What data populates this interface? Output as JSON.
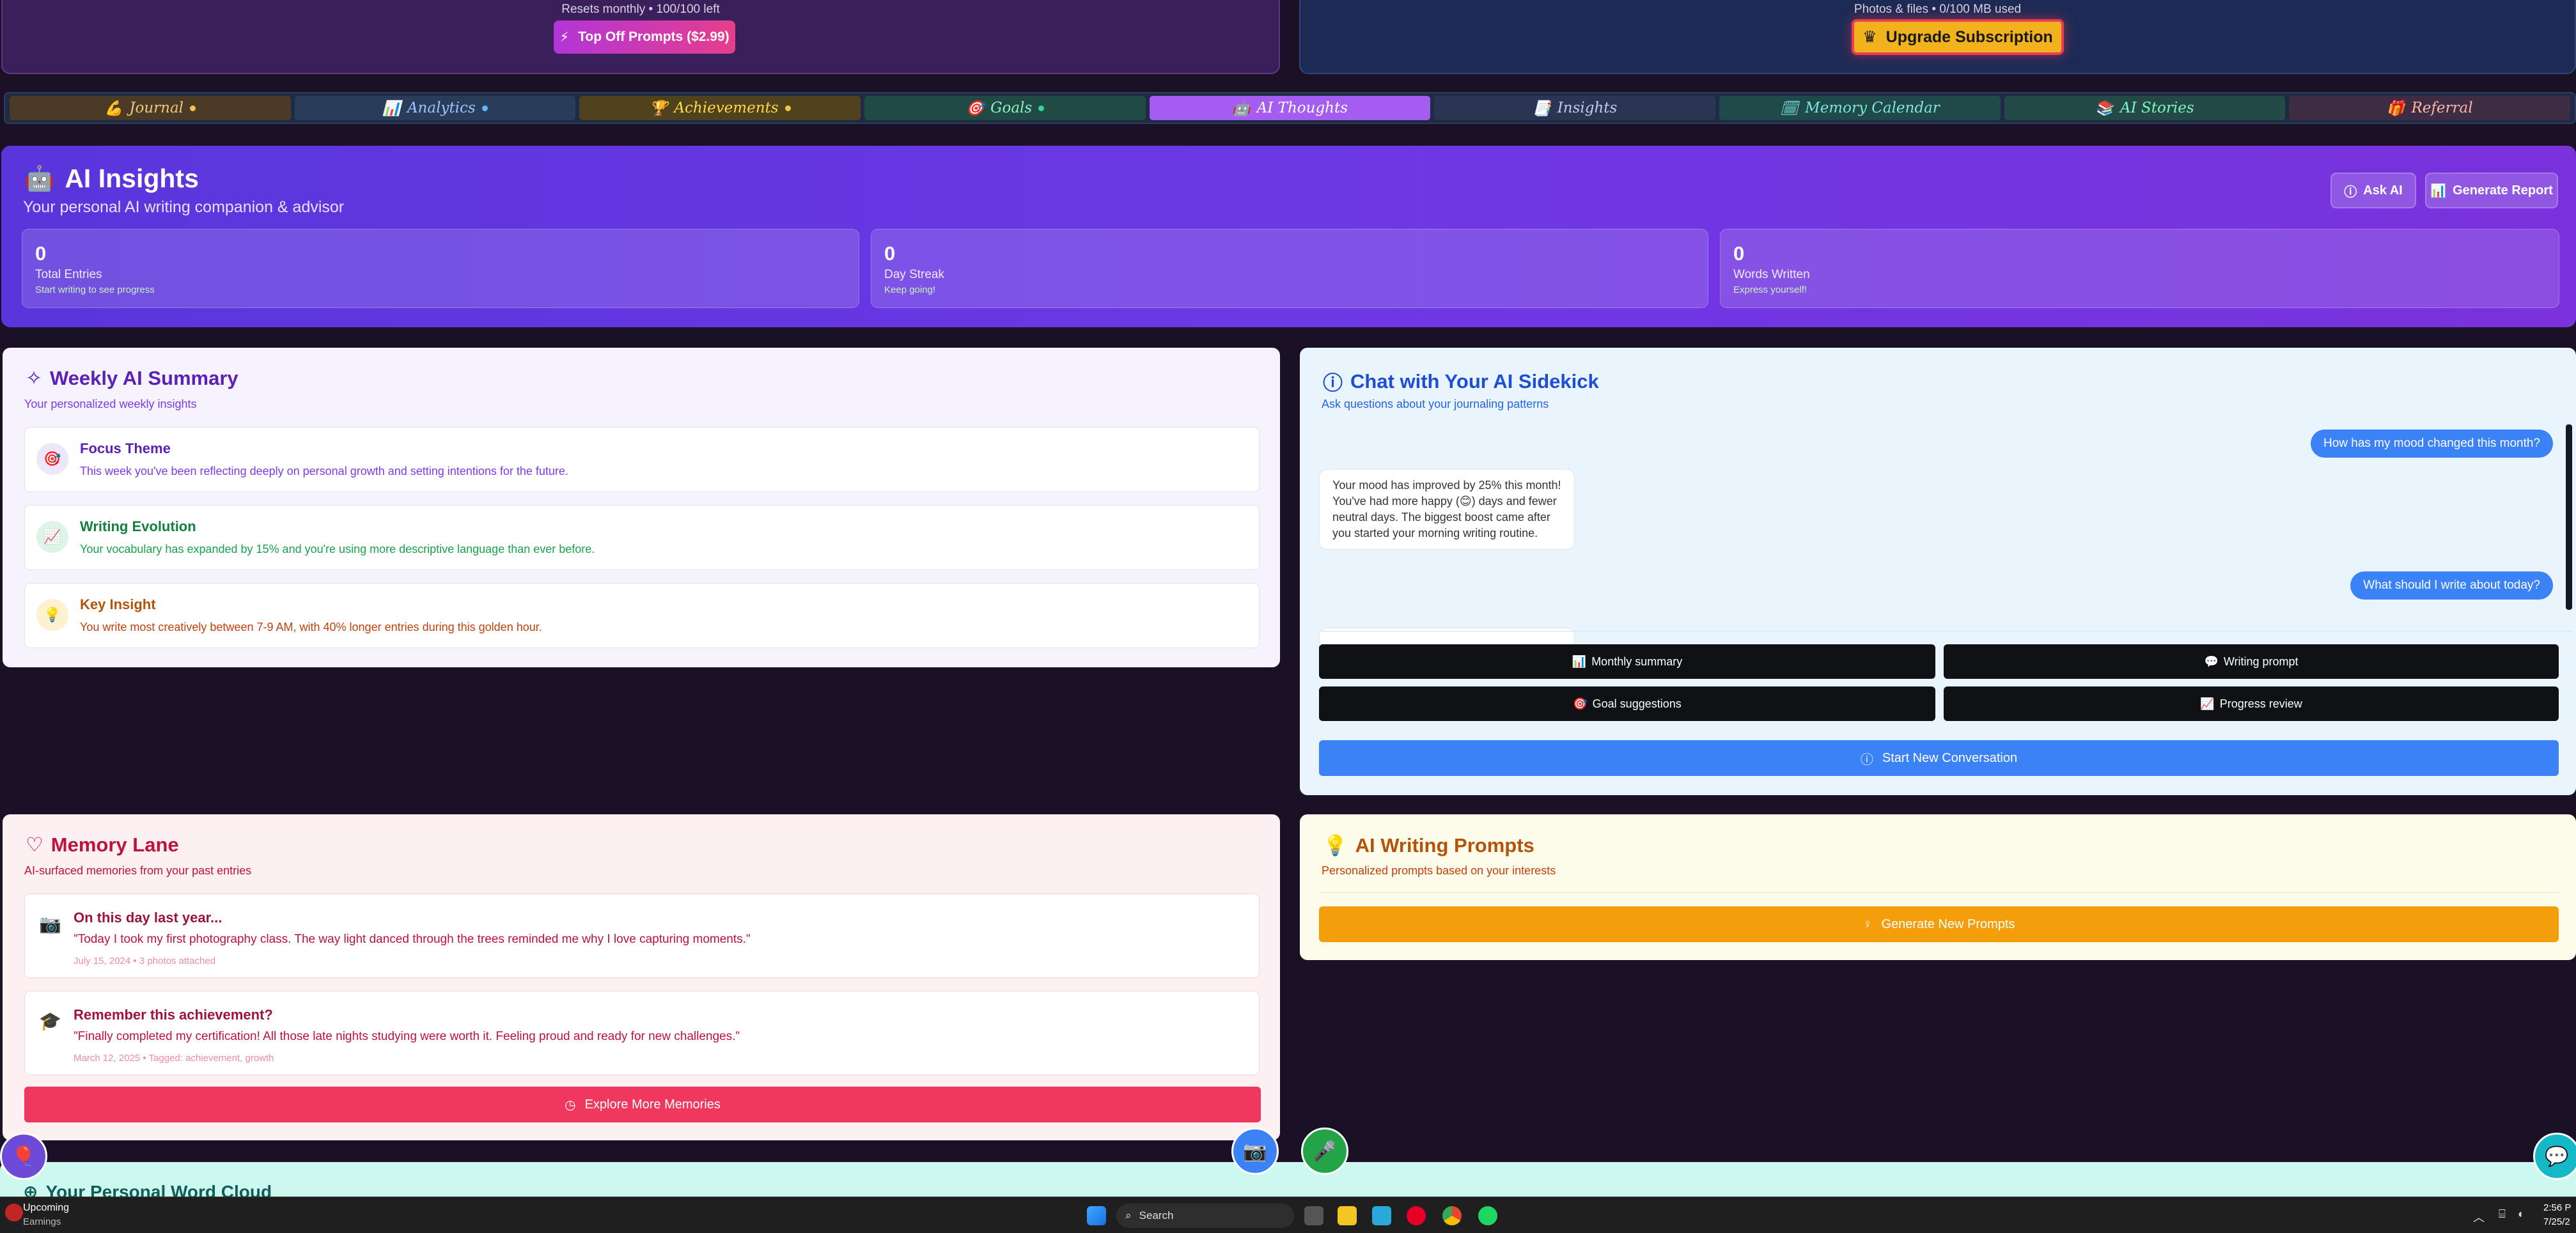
{
  "plan": {
    "prompts_note": "Resets monthly • 100/100 left",
    "topoff_label": "Top Off Prompts ($2.99)",
    "storage_note": "Photos & files • 0/100 MB used",
    "upgrade_label": "Upgrade Subscription"
  },
  "tabs": [
    {
      "icon": "💪",
      "label": "Journal"
    },
    {
      "icon": "📊",
      "label": "Analytics"
    },
    {
      "icon": "🏆",
      "label": "Achievements"
    },
    {
      "icon": "🎯",
      "label": "Goals"
    },
    {
      "icon": "🤖",
      "label": "AI Thoughts"
    },
    {
      "icon": "📑",
      "label": "Insights"
    },
    {
      "icon": "🗓",
      "label": "Memory Calendar"
    },
    {
      "icon": "📚",
      "label": "AI Stories"
    },
    {
      "icon": "🎁",
      "label": "Referral"
    }
  ],
  "hero": {
    "title": "AI Insights",
    "subtitle": "Your personal AI writing companion & advisor",
    "ask_label": "Ask AI",
    "report_label": "Generate Report",
    "stats": [
      {
        "value": "0",
        "label": "Total Entries",
        "hint": "Start writing to see progress"
      },
      {
        "value": "0",
        "label": "Day Streak",
        "hint": "Keep going!"
      },
      {
        "value": "0",
        "label": "Words Written",
        "hint": "Express yourself!"
      }
    ]
  },
  "weekly": {
    "title": "Weekly AI Summary",
    "subtitle": "Your personalized weekly insights",
    "items": [
      {
        "title": "Focus Theme",
        "text": "This week you've been reflecting deeply on personal growth and setting intentions for the future."
      },
      {
        "title": "Writing Evolution",
        "text": "Your vocabulary has expanded by 15% and you're using more descriptive language than ever before."
      },
      {
        "title": "Key Insight",
        "text": "You write most creatively between 7-9 AM, with 40% longer entries during this golden hour."
      }
    ]
  },
  "chat": {
    "title": "Chat with Your AI Sidekick",
    "subtitle": "Ask questions about your journaling patterns",
    "msg_user_1": "How has my mood changed this month?",
    "msg_ai_1": "Your mood has improved by 25% this month! You've had more happy (😊) days and fewer neutral days. The biggest boost came after you started your morning writing routine.",
    "msg_user_2": "What should I write about today?",
    "quick": [
      {
        "icon": "📊",
        "label": "Monthly summary"
      },
      {
        "icon": "💬",
        "label": "Writing prompt"
      },
      {
        "icon": "🎯",
        "label": "Goal suggestions"
      },
      {
        "icon": "📈",
        "label": "Progress review"
      }
    ],
    "start_label": "Start New Conversation"
  },
  "memory": {
    "title": "Memory Lane",
    "subtitle": "AI-surfaced memories from your past entries",
    "items": [
      {
        "icon": "📷",
        "title": "On this day last year...",
        "quote": "\"Today I took my first photography class. The way light danced through the trees reminded me why I love capturing moments.\"",
        "meta": "July 15, 2024 • 3 photos attached"
      },
      {
        "icon": "🎓",
        "title": "Remember this achievement?",
        "quote": "\"Finally completed my certification! All those late nights studying were worth it. Feeling proud and ready for new challenges.\"",
        "meta": "March 12, 2025 • Tagged: achievement, growth"
      }
    ],
    "explore_label": "Explore More Memories"
  },
  "prompts": {
    "title": "AI Writing Prompts",
    "subtitle": "Personalized prompts based on your interests",
    "generate_label": "Generate New Prompts"
  },
  "wordcloud": {
    "title": "Your Personal Word Cloud"
  },
  "taskbar": {
    "weather_title": "Upcoming",
    "weather_sub": "Earnings",
    "search_placeholder": "Search",
    "time": "2:56 P",
    "date": "7/25/2"
  }
}
